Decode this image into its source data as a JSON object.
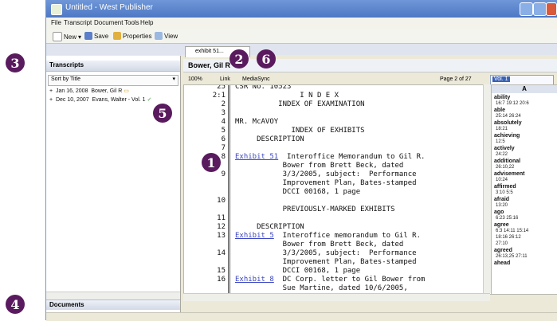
{
  "window": {
    "title": "Untitled - West Publisher"
  },
  "menu": [
    "File",
    "Transcript",
    "Document",
    "Tools",
    "Help"
  ],
  "toolbar": {
    "new_label": "New",
    "save_label": "Save",
    "properties_label": "Properties",
    "view_label": "View"
  },
  "left_panel": {
    "header": "Transcripts",
    "sort_label": "Sort by Title",
    "transcripts": [
      {
        "date": "Jan 16, 2008",
        "name": "Bower, Gil R"
      },
      {
        "date": "Dec 10, 2007",
        "name": "Evans, Walter - Vol. 1"
      }
    ],
    "footer": "Documents"
  },
  "doc_tab": {
    "label": "exhibit 51..."
  },
  "doc_header": {
    "title": "Bower, Gil R"
  },
  "doc_toolbar": {
    "zoom": "100%",
    "link_label": "Link",
    "mediasync_label": "MediaSync",
    "page_label": "Page 2 of 27",
    "search_value": "Vol. 1"
  },
  "transcript_lines": [
    {
      "n": "25",
      "text": "CSR No. 10523",
      "link": ""
    },
    {
      "n": "2:1",
      "text": "               I N D E X",
      "link": ""
    },
    {
      "n": "2",
      "text": "          INDEX OF EXAMINATION",
      "link": ""
    },
    {
      "n": "3",
      "text": "",
      "link": ""
    },
    {
      "n": "4",
      "text": "MR. McAVOY",
      "link": ""
    },
    {
      "n": "5",
      "text": "             INDEX OF EXHIBITS",
      "link": ""
    },
    {
      "n": "6",
      "text": "     DESCRIPTION",
      "link": ""
    },
    {
      "n": "7",
      "text": "",
      "link": ""
    },
    {
      "n": "8",
      "text": "  Interoffice Memorandum to Gil R.",
      "link": "Exhibit 51"
    },
    {
      "n": "",
      "text": "           Bower from Brett Beck, dated",
      "link": ""
    },
    {
      "n": "9",
      "text": "           3/3/2005, subject:  Performance",
      "link": ""
    },
    {
      "n": "",
      "text": "           Improvement Plan, Bates-stamped",
      "link": ""
    },
    {
      "n": "",
      "text": "           DCCI 00168, 1 page",
      "link": ""
    },
    {
      "n": "10",
      "text": "",
      "link": ""
    },
    {
      "n": "",
      "text": "           PREVIOUSLY-MARKED EXHIBITS",
      "link": ""
    },
    {
      "n": "11",
      "text": "",
      "link": ""
    },
    {
      "n": "12",
      "text": "     DESCRIPTION",
      "link": ""
    },
    {
      "n": "13",
      "text": "  Interoffice memorandum to Gil R.",
      "link": "Exhibit 5"
    },
    {
      "n": "",
      "text": "           Bower from Brett Beck, dated",
      "link": ""
    },
    {
      "n": "14",
      "text": "           3/3/2005, subject:  Performance",
      "link": ""
    },
    {
      "n": "",
      "text": "           Improvement Plan, Bates-stamped",
      "link": ""
    },
    {
      "n": "15",
      "text": "           DCCI 00168, 1 page",
      "link": ""
    },
    {
      "n": "16",
      "text": "  DC Corp. letter to Gil Bower from",
      "link": "Exhibit 8"
    },
    {
      "n": "",
      "text": "           Sue Martine, dated 10/6/2005,",
      "link": ""
    }
  ],
  "word_index": {
    "letter": "A",
    "entries": [
      {
        "word": "ability",
        "refs": "16:7 19:12 20:6"
      },
      {
        "word": "able",
        "refs": "25:14 26:24"
      },
      {
        "word": "absolutely",
        "refs": "18:21"
      },
      {
        "word": "achieving",
        "refs": "12:5"
      },
      {
        "word": "actively",
        "refs": "24:22"
      },
      {
        "word": "additional",
        "refs": "26:10,22"
      },
      {
        "word": "advisement",
        "refs": "10:24"
      },
      {
        "word": "affirmed",
        "refs": "3:10 5:5"
      },
      {
        "word": "afraid",
        "refs": "13:20"
      },
      {
        "word": "ago",
        "refs": "6:23 25:16"
      },
      {
        "word": "agree",
        "refs": "6:3 14:11 15:14"
      },
      {
        "word": "",
        "refs": "18:16 26:12"
      },
      {
        "word": "",
        "refs": "27:10"
      },
      {
        "word": "agreed",
        "refs": "26:13,25 27:11"
      },
      {
        "word": "ahead",
        "refs": ""
      }
    ]
  },
  "callouts": [
    "1",
    "2",
    "3",
    "4",
    "5",
    "6"
  ],
  "colors": {
    "callout": "#5a1b5e",
    "titlebar": "#4d78c4",
    "link": "#3b46c2"
  }
}
